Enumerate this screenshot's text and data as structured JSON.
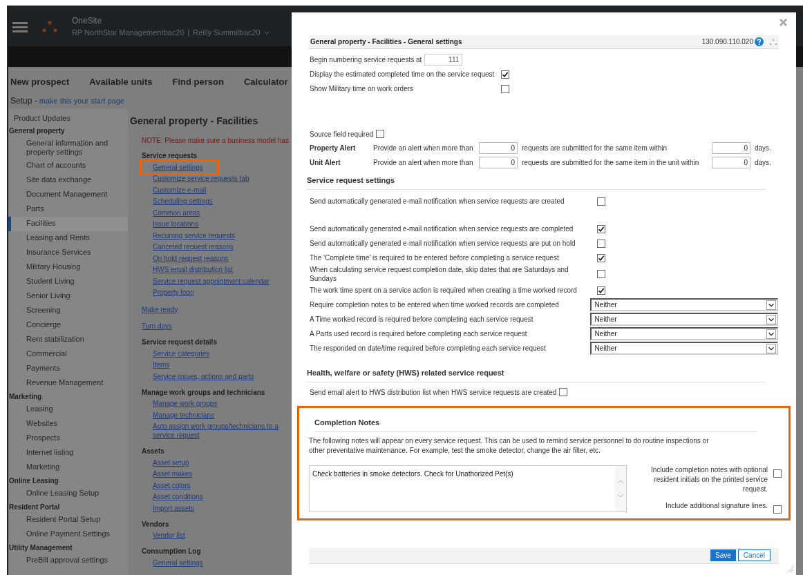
{
  "app_header": {
    "app_name": "OneSite",
    "company": "RP NorthStar Managementbac20",
    "separator": "|",
    "property": "Reilly Summitbac20"
  },
  "nav": [
    "New prospect",
    "Available units",
    "Find person",
    "Calculator"
  ],
  "setup": {
    "title": "Setup -",
    "link": "make this your start page"
  },
  "sidebar": {
    "top_item": "Product Updates",
    "groups": [
      {
        "label": "General property",
        "items": [
          {
            "label": "General information and property settings",
            "selected": false
          },
          {
            "label": "Chart of accounts",
            "selected": false
          },
          {
            "label": "Site data exchange",
            "selected": false
          },
          {
            "label": "Document Management",
            "selected": false
          },
          {
            "label": "Parts",
            "selected": false
          },
          {
            "label": "Facilities",
            "selected": true
          },
          {
            "label": "Leasing and Rents",
            "selected": false
          },
          {
            "label": "Insurance Services",
            "selected": false
          },
          {
            "label": "Military Housing",
            "selected": false
          },
          {
            "label": "Student Living",
            "selected": false
          },
          {
            "label": "Senior Living",
            "selected": false
          },
          {
            "label": "Screening",
            "selected": false
          },
          {
            "label": "Concierge",
            "selected": false
          },
          {
            "label": "Rent stabilization",
            "selected": false
          },
          {
            "label": "Commercial",
            "selected": false
          },
          {
            "label": "Payments",
            "selected": false
          },
          {
            "label": "Revenue Management",
            "selected": false
          }
        ]
      },
      {
        "label": "Marketing",
        "items": [
          {
            "label": "Leasing",
            "selected": false
          },
          {
            "label": "Websites",
            "selected": false
          },
          {
            "label": "Prospects",
            "selected": false
          },
          {
            "label": "Internet listing",
            "selected": false
          },
          {
            "label": "Marketing",
            "selected": false
          }
        ]
      },
      {
        "label": "Online Leasing",
        "items": [
          {
            "label": "Online Leasing Setup",
            "selected": false
          }
        ]
      },
      {
        "label": "Resident Portal",
        "items": [
          {
            "label": "Resident Portal Setup",
            "selected": false
          },
          {
            "label": "Online Payment Settings",
            "selected": false
          }
        ]
      },
      {
        "label": "Utility Management",
        "items": [
          {
            "label": "PreBill approval settings",
            "selected": false
          }
        ]
      }
    ]
  },
  "content": {
    "title": "General property - Facilities",
    "note": "NOTE: Please make sure a business model has",
    "sections": [
      {
        "heading": "Service requests",
        "links": [
          {
            "label": "General settings",
            "highlighted": true
          },
          {
            "label": "Customize service requests tab",
            "highlighted": false
          },
          {
            "label": "Customize e-mail",
            "highlighted": false
          },
          {
            "label": "Scheduling settings",
            "highlighted": false
          },
          {
            "label": "Common areas",
            "highlighted": false
          },
          {
            "label": "Issue locations",
            "highlighted": false
          },
          {
            "label": "Recurring service requests",
            "highlighted": false
          },
          {
            "label": "Canceled request reasons",
            "highlighted": false
          },
          {
            "label": "On hold request reasons",
            "highlighted": false
          },
          {
            "label": "HWS email distribution list",
            "highlighted": false
          },
          {
            "label": "Service request appointment calendar",
            "highlighted": false
          },
          {
            "label": "Property logo",
            "highlighted": false
          }
        ]
      },
      {
        "links": [
          {
            "label": "Make ready",
            "highlighted": false
          }
        ]
      },
      {
        "links": [
          {
            "label": "Turn days",
            "highlighted": false
          }
        ]
      },
      {
        "heading": "Service request details",
        "links": [
          {
            "label": "Service categories",
            "highlighted": false
          },
          {
            "label": "Items",
            "highlighted": false
          },
          {
            "label": "Service issues, actions and parts",
            "highlighted": false
          }
        ]
      },
      {
        "heading": "Manage work groups and technicians",
        "links": [
          {
            "label": "Manage work groups",
            "highlighted": false
          },
          {
            "label": "Manage technicians",
            "highlighted": false
          },
          {
            "label": "Auto assign work groups/technicians to a service request",
            "highlighted": false
          }
        ]
      },
      {
        "heading": "Assets",
        "links": [
          {
            "label": "Asset setup",
            "highlighted": false
          },
          {
            "label": "Asset makes",
            "highlighted": false
          },
          {
            "label": "Asset colors",
            "highlighted": false
          },
          {
            "label": "Asset conditions",
            "highlighted": false
          },
          {
            "label": "Import assets",
            "highlighted": false
          }
        ]
      },
      {
        "heading": "Vendors",
        "links": [
          {
            "label": "Vendor list",
            "highlighted": false
          }
        ]
      },
      {
        "heading": "Consumption Log",
        "links": [
          {
            "label": "General settings",
            "highlighted": false
          }
        ]
      }
    ]
  },
  "modal": {
    "title": "General property - Facilities - General settings",
    "code": "130.090.110.020",
    "begin_numbering": {
      "label": "Begin numbering service requests at",
      "value": "111"
    },
    "top_checks": [
      {
        "label": "Display the estimated completed time on the service request",
        "checked": true
      },
      {
        "label": "Show Military time on work orders",
        "checked": false
      }
    ],
    "source_field": {
      "label": "Source field required",
      "checked": false
    },
    "alerts": [
      {
        "label": "Property Alert",
        "text": "Provide an alert when more than",
        "count": "0",
        "condition": "requests are submitted for the same item within",
        "days": "0",
        "unit": "days."
      },
      {
        "label": "Unit Alert",
        "text": "Provide an alert when more than",
        "count": "0",
        "condition": "requests are submitted for the same item in the unit within",
        "days": "0",
        "unit": "days."
      }
    ],
    "service_request_settings": {
      "heading": "Service request settings",
      "rows": [
        {
          "kind": "checkbox",
          "label": "Send automatically generated e-mail notification when service requests are created",
          "checked": false
        },
        {
          "kind": "checkbox",
          "label": "Send automatically generated e-mail notification when service requests are completed",
          "checked": true
        },
        {
          "kind": "checkbox",
          "label": "Send automatically generated e-mail notification when service requests are put on hold",
          "checked": false
        },
        {
          "kind": "checkbox",
          "label": "The 'Complete time' is required to be entered before completing a service request",
          "checked": true
        },
        {
          "kind": "checkbox",
          "label": "When calculating service request completion date, skip dates that are Saturdays and Sundays",
          "checked": false
        },
        {
          "kind": "checkbox",
          "label": "The work time spent on a service action is required when creating a time worked record",
          "checked": true
        },
        {
          "kind": "select",
          "label": "Require completion notes to be entered when time worked records are completed",
          "value": "Neither"
        },
        {
          "kind": "select",
          "label": "A Time worked record is required before completing each service request",
          "value": "Neither"
        },
        {
          "kind": "select",
          "label": "A Parts used record is required before completing each service request",
          "value": "Neither"
        },
        {
          "kind": "select",
          "label": "The responded on date/time required before completing each service request",
          "value": "Neither"
        }
      ]
    },
    "hws": {
      "heading": "Health, welfare or safety (HWS) related service request",
      "label": "Send email alert to HWS distribution list when HWS service requests are created",
      "checked": false
    },
    "completion_notes": {
      "highlighted": true,
      "heading": "Completion Notes",
      "description": "The following notes will appear on every service request. This can be used to remind service personnel to do routine inspections or other preventative maintenance. For example, test the smoke detector, change the air filter, etc.",
      "notes": "Check batteries in smoke detectors. Check for Unathorized Pet(s)",
      "options": [
        {
          "label": "Include completion notes with optional resident initials on the printed service request.",
          "checked": false
        },
        {
          "label": "Include additional signature lines.",
          "checked": false
        }
      ]
    },
    "buttons": [
      {
        "label": "Save",
        "kind": "primary"
      },
      {
        "label": "Cancel",
        "kind": "secondary"
      }
    ]
  }
}
